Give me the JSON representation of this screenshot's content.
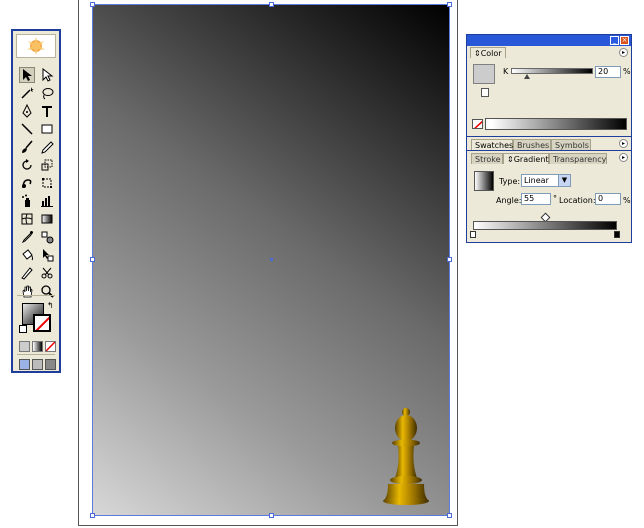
{
  "tools": [
    "selection-tool",
    "direct-selection-tool",
    "magic-wand-tool",
    "lasso-tool",
    "pen-tool",
    "type-tool",
    "line-segment-tool",
    "rectangle-tool",
    "paintbrush-tool",
    "pencil-tool",
    "rotate-tool",
    "scale-tool",
    "warp-tool",
    "free-transform-tool",
    "symbol-sprayer-tool",
    "column-graph-tool",
    "mesh-tool",
    "gradient-tool",
    "eyedropper-tool",
    "blend-tool",
    "live-paint-bucket-tool",
    "live-paint-selection-tool",
    "slice-tool",
    "scissors-tool",
    "hand-tool",
    "zoom-tool"
  ],
  "color_panel": {
    "tab": "Color",
    "channel_label": "K",
    "k_value": "20",
    "unit": "%",
    "k_fraction": 0.2,
    "fill_color": "#cccccc"
  },
  "swatches_group": {
    "tabs": [
      "Swatches",
      "Brushes",
      "Symbols"
    ]
  },
  "gradient_panel": {
    "tabs": [
      "Stroke",
      "Gradient",
      "Transparency"
    ],
    "type_label": "Type:",
    "type_value": "Linear",
    "angle_label": "Angle:",
    "angle_value": "55",
    "degree_symbol": "°",
    "location_label": "Location:",
    "location_value": "0",
    "location_unit": "%",
    "midpoint_fraction": 0.5,
    "stops": [
      {
        "color": "#ffffff",
        "position": 0
      },
      {
        "color": "#000000",
        "position": 1
      }
    ]
  },
  "canvas": {
    "gradient_angle": 55,
    "object": "chess pawn"
  },
  "colors": {
    "panel_bg": "#ece9d8",
    "titlebar": "#2858d8",
    "selection": "#4a6ad8"
  }
}
